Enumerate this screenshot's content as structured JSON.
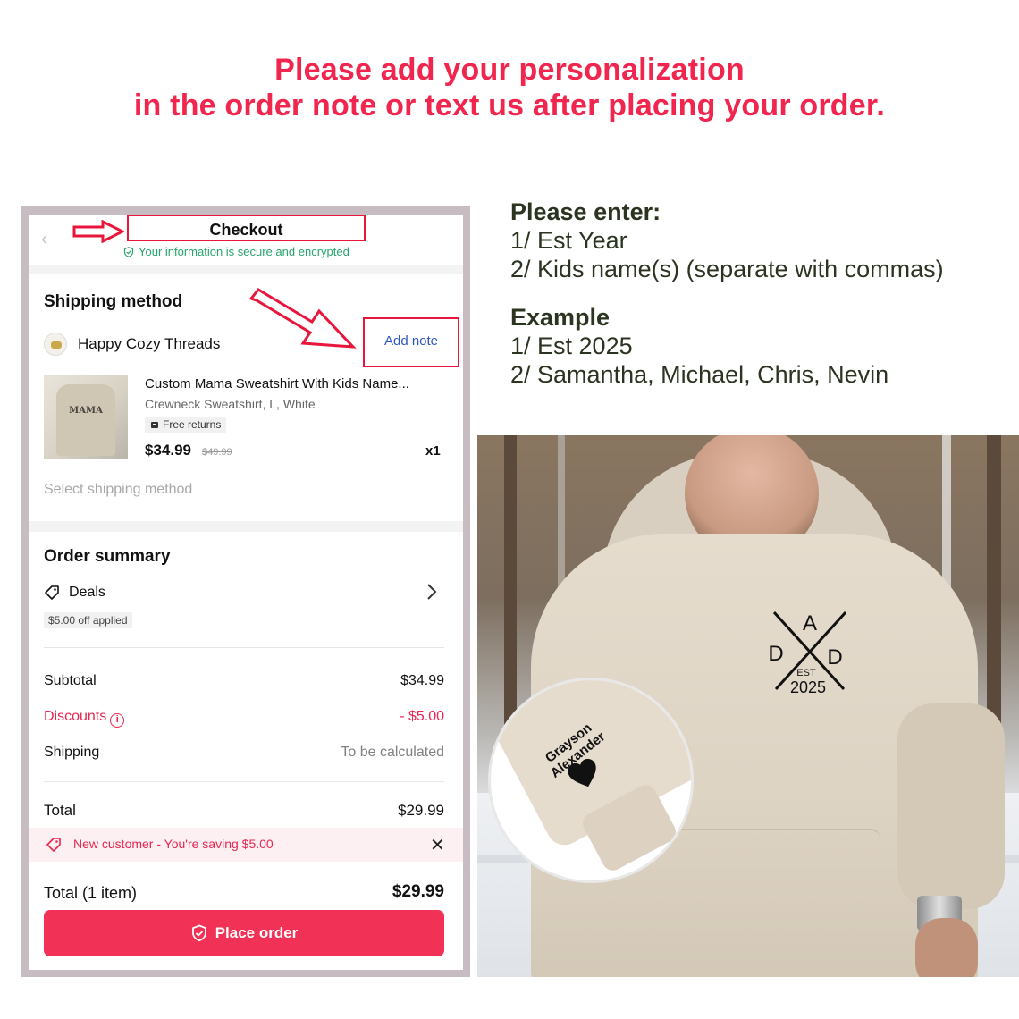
{
  "banner": {
    "line1": "Please add your personalization",
    "line2": "in the order note or text us after placing your order."
  },
  "checkout": {
    "title": "Checkout",
    "secure_text": "Your information is secure and encrypted",
    "shipping_method_title": "Shipping method",
    "store_name": "Happy Cozy Threads",
    "add_note": "Add note",
    "product": {
      "name": "Custom Mama Sweatshirt With Kids Name...",
      "variant": "Crewneck Sweatshirt, L, White",
      "badge": "Free returns",
      "price": "$34.99",
      "old_price": "$49.99",
      "qty": "x1",
      "image_text": "MAMA"
    },
    "select_shipping": "Select shipping method",
    "order_summary_title": "Order summary",
    "deals_label": "Deals",
    "deals_badge": "$5.00 off applied",
    "subtotal_label": "Subtotal",
    "subtotal_value": "$34.99",
    "discounts_label": "Discounts",
    "discounts_value": "- $5.00",
    "shipping_label": "Shipping",
    "shipping_value": "To be calculated",
    "total_label": "Total",
    "total_value": "$29.99",
    "promo_text": "New customer - You're saving $5.00",
    "total_items_label": "Total (1 item)",
    "total_items_value": "$29.99",
    "place_order": "Place order"
  },
  "instructions": {
    "heading1": "Please enter:",
    "line1": "1/ Est Year",
    "line2": "2/ Kids name(s) (separate with commas)",
    "heading2": "Example",
    "example1": "1/ Est 2025",
    "example2": "2/ Samantha, Michael, Chris, Nevin"
  },
  "photo": {
    "dad_top": "A",
    "dad_left": "D",
    "dad_right": "D",
    "dad_est": "EST",
    "dad_year": "2025",
    "sleeve_line1": "Grayson",
    "sleeve_line2": "Alexander"
  },
  "colors": {
    "accent": "#f23157",
    "banner": "#f0264f",
    "link": "#2f57c2",
    "secure": "#26a56c",
    "highlight_box": "#e8163b"
  }
}
